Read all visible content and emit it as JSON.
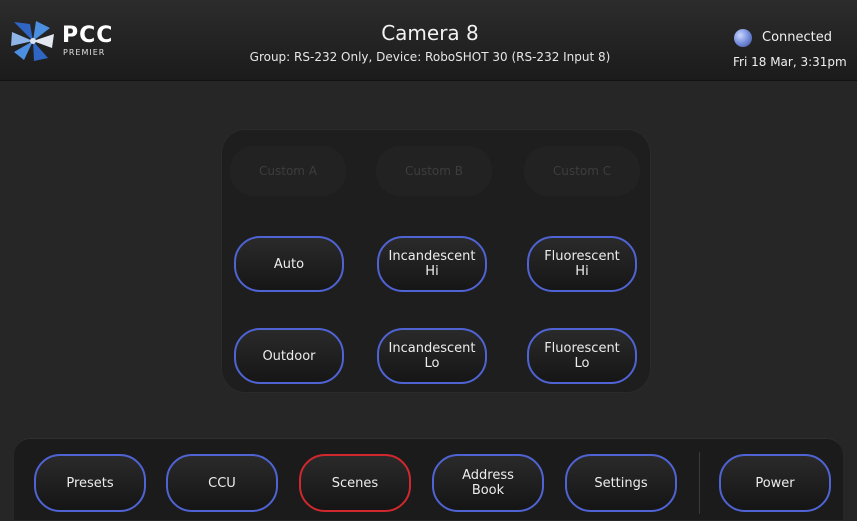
{
  "header": {
    "logo_text": "PCC",
    "logo_subtext": "PREMIER",
    "title": "Camera 8",
    "subtitle": "Group: RS-232 Only,  Device: RoboSHOT 30 (RS-232 Input 8)",
    "status": "Connected",
    "datetime": "Fri 18 Mar, 3:31pm"
  },
  "custom_buttons": [
    "Custom A",
    "Custom B",
    "Custom C"
  ],
  "white_balance_buttons": [
    {
      "label": "Auto"
    },
    {
      "label": "Incandescent\nHi"
    },
    {
      "label": "Fluorescent\nHi"
    },
    {
      "label": "Outdoor"
    },
    {
      "label": "Incandescent\nLo"
    },
    {
      "label": "Fluorescent\nLo"
    }
  ],
  "nav": [
    {
      "label": "Presets",
      "active": false
    },
    {
      "label": "CCU",
      "active": false
    },
    {
      "label": "Scenes",
      "active": true
    },
    {
      "label": "Address\nBook",
      "active": false
    },
    {
      "label": "Settings",
      "active": false
    },
    {
      "label": "Power",
      "active": false
    }
  ],
  "colors": {
    "accent": "#4f63d3",
    "active": "#d0282e",
    "status_dot": "#6f86d8"
  }
}
